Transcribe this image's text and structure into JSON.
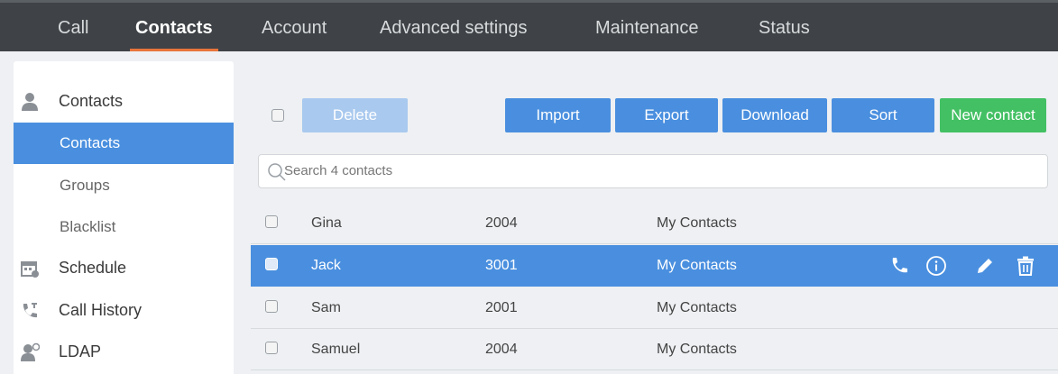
{
  "nav": {
    "tabs": [
      {
        "label": "Call"
      },
      {
        "label": "Contacts"
      },
      {
        "label": "Account"
      },
      {
        "label": "Advanced settings"
      },
      {
        "label": "Maintenance"
      },
      {
        "label": "Status"
      }
    ],
    "active": "Contacts"
  },
  "sidebar": {
    "contacts": "Contacts",
    "sub_contacts": "Contacts",
    "groups": "Groups",
    "blacklist": "Blacklist",
    "schedule": "Schedule",
    "call_history": "Call History",
    "ldap": "LDAP"
  },
  "toolbar": {
    "delete": "Delete",
    "import": "Import",
    "export": "Export",
    "download": "Download",
    "sort": "Sort",
    "new_contact": "New contact"
  },
  "search": {
    "placeholder": "Search 4 contacts"
  },
  "contacts": [
    {
      "name": "Gina",
      "number": "2004",
      "group": "My Contacts"
    },
    {
      "name": "Jack",
      "number": "3001",
      "group": "My Contacts",
      "selected": true
    },
    {
      "name": "Sam",
      "number": "2001",
      "group": "My Contacts"
    },
    {
      "name": "Samuel",
      "number": "2004",
      "group": "My Contacts"
    }
  ],
  "row_actions": [
    "phone-icon",
    "info-icon",
    "edit-icon",
    "trash-icon"
  ],
  "colors": {
    "accent": "#4a8fdf",
    "new_contact": "#43c063",
    "nav_bg": "#3f4347",
    "nav_underline": "#e9743b"
  }
}
